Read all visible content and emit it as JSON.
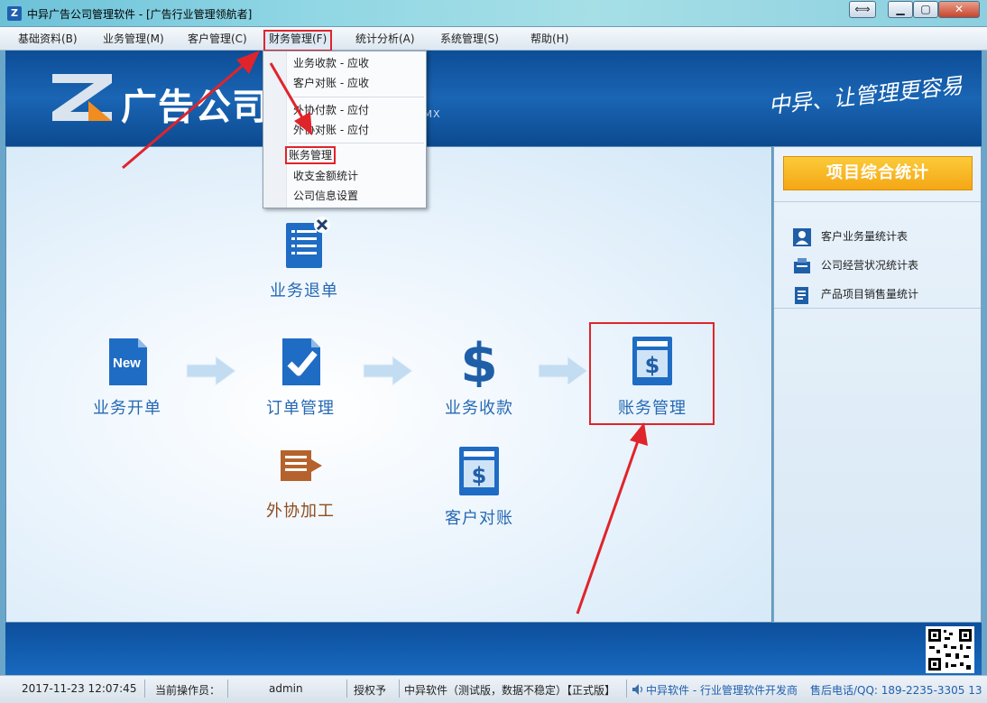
{
  "window": {
    "title": "中异广告公司管理软件 - [广告行业管理领航者]",
    "logo_letter": "Z",
    "resize_label": "⟺",
    "minimize_label": "▁",
    "maximize_label": "▢",
    "close_label": "✕"
  },
  "menu": {
    "items": [
      {
        "label": "基础资料(B)"
      },
      {
        "label": "业务管理(M)"
      },
      {
        "label": "客户管理(C)"
      },
      {
        "label": "财务管理(F)"
      },
      {
        "label": "统计分析(A)"
      },
      {
        "label": "系统管理(S)"
      },
      {
        "label": "帮助(H)"
      }
    ],
    "active_index": 3
  },
  "dropdown": {
    "items": [
      {
        "label": "业务收款  -  应收"
      },
      {
        "label": "客户对账  -  应收"
      },
      {
        "label": "外协付款  -  应付"
      },
      {
        "label": "外协对账  -  应付"
      },
      {
        "label": "账务管理"
      },
      {
        "label": "收支金额统计"
      },
      {
        "label": "公司信息设置"
      }
    ],
    "highlighted_index": 4
  },
  "banner": {
    "title": "广告公司",
    "subtitle": "DMX",
    "slogan": "中异、让管理更容易"
  },
  "flow": {
    "new_badge": "New",
    "items": {
      "refund": "业务退单",
      "open_order": "业务开单",
      "order_mgmt": "订单管理",
      "collection": "业务收款",
      "accounting": "账务管理",
      "outsource": "外协加工",
      "reconcile": "客户对账"
    }
  },
  "right_panel": {
    "title": "项目综合统计",
    "items": [
      {
        "label": "客户业务量统计表"
      },
      {
        "label": "公司经营状况统计表"
      },
      {
        "label": "产品项目销售量统计"
      }
    ]
  },
  "status": {
    "datetime": "2017-11-23 12:07:45",
    "operator_label": "当前操作员：",
    "operator": "admin",
    "auth_label": "授权予",
    "license": "中异软件（测试版，数据不稳定）【正式版】",
    "vendor": "中异软件 - 行业管理软件开发商",
    "phone": "售后电话/QQ:  189-2235-3305  13"
  },
  "colors": {
    "accent_blue": "#2669b3",
    "highlight_red": "#e0242b",
    "panel_title_orange": "#f5a715"
  }
}
